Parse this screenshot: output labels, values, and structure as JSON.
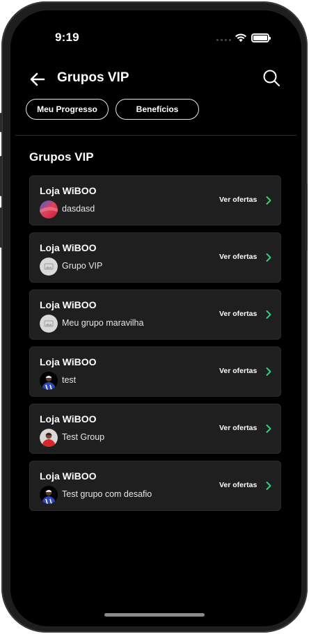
{
  "status_bar": {
    "time": "9:19"
  },
  "header": {
    "title": "Grupos VIP"
  },
  "tabs": [
    {
      "label": "Meu Progresso"
    },
    {
      "label": "Benefícios"
    }
  ],
  "section": {
    "title": "Grupos VIP"
  },
  "groups": [
    {
      "store": "Loja WiBOO",
      "name": "dasdasd",
      "action": "Ver ofertas",
      "avatar": "gradient-avatar-icon"
    },
    {
      "store": "Loja WiBOO",
      "name": "Grupo VIP",
      "action": "Ver ofertas",
      "avatar": "image-placeholder-icon"
    },
    {
      "store": "Loja WiBOO",
      "name": "Meu grupo maravilha",
      "action": "Ver ofertas",
      "avatar": "image-placeholder-icon"
    },
    {
      "store": "Loja WiBOO",
      "name": "test",
      "action": "Ver ofertas",
      "avatar": "player-photo-icon"
    },
    {
      "store": "Loja WiBOO",
      "name": "Test Group",
      "action": "Ver ofertas",
      "avatar": "player-red-photo-icon"
    },
    {
      "store": "Loja WiBOO",
      "name": "Test grupo com desafio",
      "action": "Ver ofertas",
      "avatar": "player-photo-icon"
    }
  ],
  "colors": {
    "accent": "#2fd27a",
    "background": "#000000",
    "card": "#1f1f1f"
  }
}
